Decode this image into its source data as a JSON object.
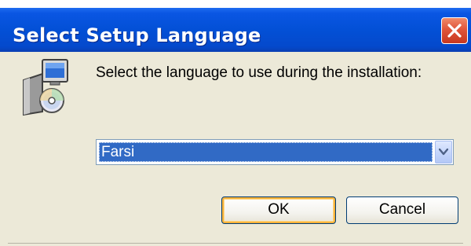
{
  "window": {
    "title": "Select Setup Language"
  },
  "dialog": {
    "prompt": "Select the language to use during the installation:",
    "language_select": {
      "selected": "Farsi"
    },
    "ok_label": "OK",
    "cancel_label": "Cancel"
  },
  "icons": {
    "close": "close-icon",
    "setup": "setup-icon",
    "dropdown": "chevron-down-icon"
  },
  "colors": {
    "titlebar": "#0350d6",
    "selection": "#316ac5",
    "dialog_bg": "#ece9d8",
    "close_button": "#e0553a"
  }
}
